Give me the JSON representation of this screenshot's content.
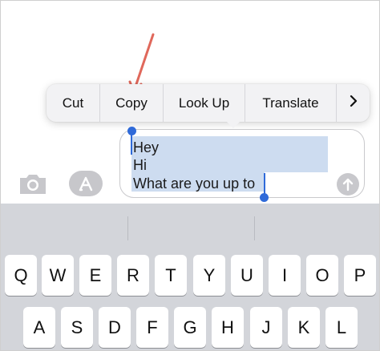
{
  "context_menu": {
    "items": [
      "Cut",
      "Copy",
      "Look Up",
      "Translate"
    ],
    "more_label": ">"
  },
  "message": {
    "lines": [
      "Hey",
      "Hi",
      "What are you up to"
    ]
  },
  "icons": {
    "camera": "camera-icon",
    "appstore": "appstore-icon",
    "send": "send-arrow-icon",
    "more": "chevron-right-icon",
    "annotation": "red-arrow-annotation"
  },
  "colors": {
    "selection": "#cddcf0",
    "handle": "#2f6ad9",
    "annotation_arrow": "#e0685b",
    "keyboard_bg": "#d3d5da"
  },
  "keyboard": {
    "row1": [
      "Q",
      "W",
      "E",
      "R",
      "T",
      "Y",
      "U",
      "I",
      "O",
      "P"
    ],
    "row2": [
      "A",
      "S",
      "D",
      "F",
      "G",
      "H",
      "J",
      "K",
      "L"
    ]
  }
}
